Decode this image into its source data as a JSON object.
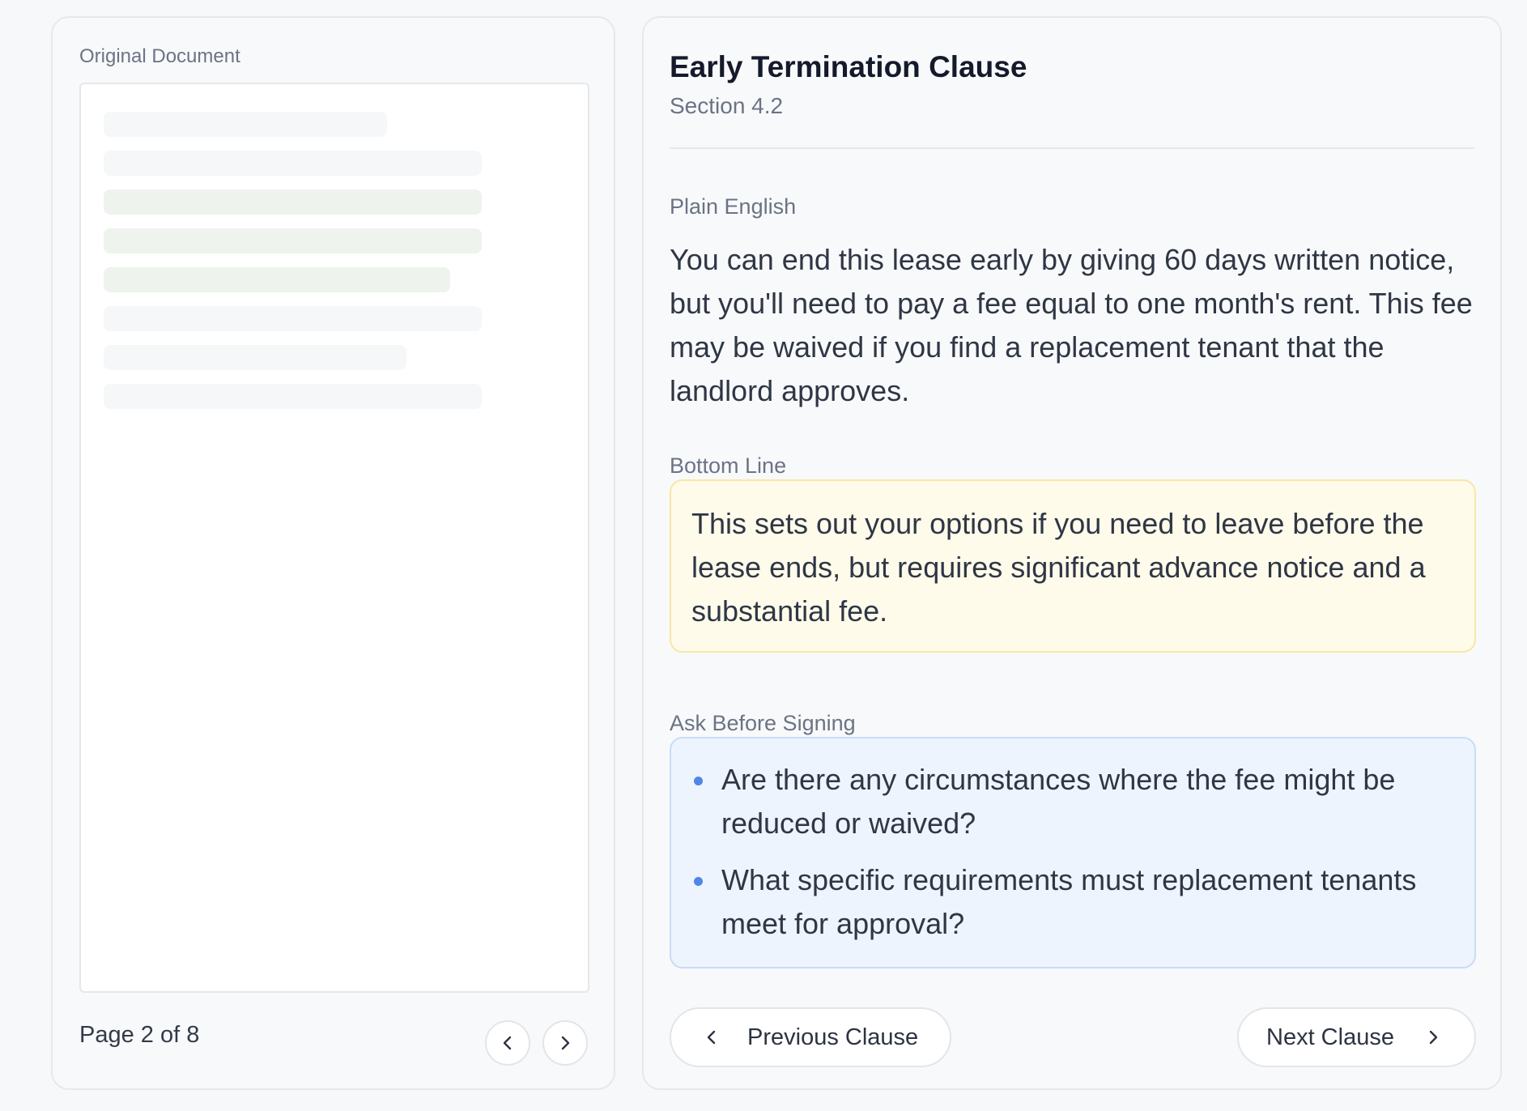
{
  "document_viewer": {
    "label": "Original Document",
    "page_indicator": "Page 2 of 8"
  },
  "clause": {
    "title": "Early Termination Clause",
    "section": "Section 4.2"
  },
  "plain_english": {
    "label": "Plain English",
    "text": "You can end this lease early by giving 60 days written notice, but you'll need to pay a fee equal to one month's rent. This fee may be waived if you find a replacement tenant that the landlord approves."
  },
  "bottom_line": {
    "label": "Bottom Line",
    "text": "This sets out your options if you need to leave before the lease ends, but requires significant advance notice and a substantial fee."
  },
  "ask_before_signing": {
    "label": "Ask Before Signing",
    "items": [
      "Are there any circumstances where the fee might be reduced or waived?",
      "What specific requirements must replacement tenants meet for approval?"
    ]
  },
  "navigation": {
    "previous_label": "Previous Clause",
    "next_label": "Next Clause"
  },
  "colors": {
    "highlight_lines": "#eef3ee",
    "bottom_line_bg": "#fefbea",
    "ask_bg": "#eef4fd",
    "bullet": "#4f86e8"
  }
}
